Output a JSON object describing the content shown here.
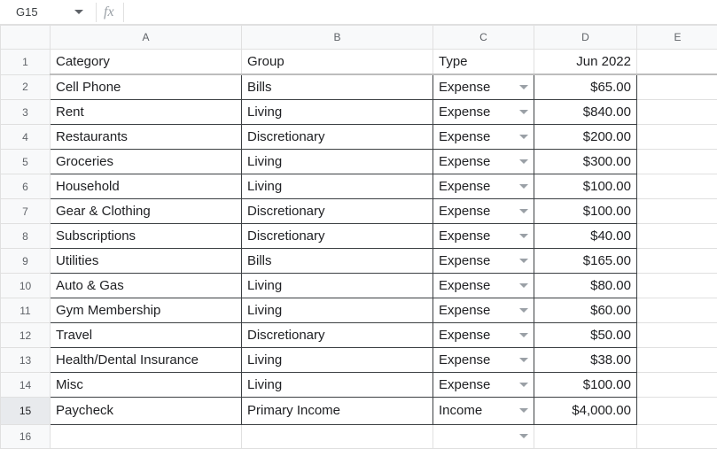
{
  "formulabar": {
    "namebox_value": "G15",
    "fx_label": "fx",
    "formula_value": ""
  },
  "columns": {
    "A": "A",
    "B": "B",
    "C": "C",
    "D": "D",
    "E": "E"
  },
  "header": {
    "category": "Category",
    "group": "Group",
    "type": "Type",
    "month": "Jun 2022"
  },
  "rows": [
    {
      "num": "2",
      "category": "Cell Phone",
      "group": "Bills",
      "type": "Expense",
      "amount": "$65.00"
    },
    {
      "num": "3",
      "category": "Rent",
      "group": "Living",
      "type": "Expense",
      "amount": "$840.00"
    },
    {
      "num": "4",
      "category": "Restaurants",
      "group": "Discretionary",
      "type": "Expense",
      "amount": "$200.00"
    },
    {
      "num": "5",
      "category": "Groceries",
      "group": "Living",
      "type": "Expense",
      "amount": "$300.00"
    },
    {
      "num": "6",
      "category": "Household",
      "group": "Living",
      "type": "Expense",
      "amount": "$100.00"
    },
    {
      "num": "7",
      "category": "Gear & Clothing",
      "group": "Discretionary",
      "type": "Expense",
      "amount": "$100.00"
    },
    {
      "num": "8",
      "category": "Subscriptions",
      "group": "Discretionary",
      "type": "Expense",
      "amount": "$40.00"
    },
    {
      "num": "9",
      "category": "Utilities",
      "group": "Bills",
      "type": "Expense",
      "amount": "$165.00"
    },
    {
      "num": "10",
      "category": "Auto & Gas",
      "group": "Living",
      "type": "Expense",
      "amount": "$80.00"
    },
    {
      "num": "11",
      "category": "Gym Membership",
      "group": "Living",
      "type": "Expense",
      "amount": "$60.00"
    },
    {
      "num": "12",
      "category": "Travel",
      "group": "Discretionary",
      "type": "Expense",
      "amount": "$50.00"
    },
    {
      "num": "13",
      "category": "Health/Dental Insurance",
      "group": "Living",
      "type": "Expense",
      "amount": "$38.00"
    },
    {
      "num": "14",
      "category": "Misc",
      "group": "Living",
      "type": "Expense",
      "amount": "$100.00"
    },
    {
      "num": "15",
      "category": "Paycheck",
      "group": "Primary Income",
      "type": "Income",
      "amount": "$4,000.00"
    }
  ],
  "row_labels": {
    "header": "1",
    "blank": "16"
  }
}
